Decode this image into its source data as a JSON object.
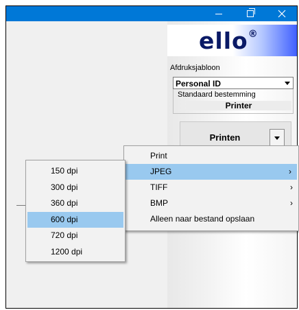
{
  "window": {
    "accent_color": "#0078d7",
    "controls": [
      "minimize-icon",
      "maximize-icon",
      "close-icon"
    ]
  },
  "logo": {
    "text": "ello",
    "mark": "®"
  },
  "panel": {
    "template_label": "Afdruksjabloon",
    "template_value": "Personal ID",
    "destination_label": "Standaard bestemming",
    "destination_value": "Printer",
    "print_button_label": "Printen"
  },
  "context_menu": {
    "items": [
      {
        "label": "Print",
        "has_submenu": false,
        "highlighted": false
      },
      {
        "label": "JPEG",
        "has_submenu": true,
        "highlighted": true
      },
      {
        "label": "TIFF",
        "has_submenu": true,
        "highlighted": false
      },
      {
        "label": "BMP",
        "has_submenu": true,
        "highlighted": false
      },
      {
        "label": "Alleen naar bestand opslaan",
        "has_submenu": false,
        "highlighted": false
      }
    ],
    "submenu_arrow": "›"
  },
  "dpi_submenu": {
    "items": [
      "150 dpi",
      "300 dpi",
      "360 dpi",
      "600 dpi",
      "720 dpi",
      "1200 dpi"
    ],
    "highlighted": "600 dpi"
  },
  "colors": {
    "menu_highlight": "#99c9ef",
    "logo_text": "#0a1a66"
  }
}
